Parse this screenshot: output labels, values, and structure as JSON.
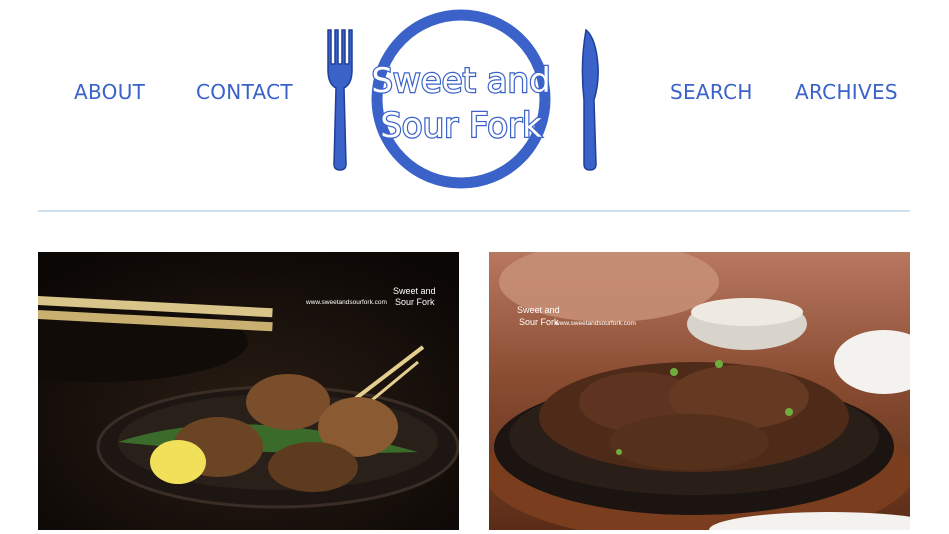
{
  "nav": {
    "left": [
      {
        "label": "ABOUT"
      },
      {
        "label": "CONTACT"
      }
    ],
    "right": [
      {
        "label": "SEARCH"
      },
      {
        "label": "ARCHIVES"
      }
    ]
  },
  "logo": {
    "line1": "Sweet and",
    "line2": "Sour Fork",
    "color": "#3a62c8"
  },
  "posts": [
    {
      "watermark_url": "www.sweetandsourfork.com",
      "watermark_line1": "Sweet and",
      "watermark_line2": "Sour Fork"
    },
    {
      "watermark_url": "www.sweetandsourfork.com",
      "watermark_line1": "Sweet and",
      "watermark_line2": "Sour Fork"
    }
  ]
}
